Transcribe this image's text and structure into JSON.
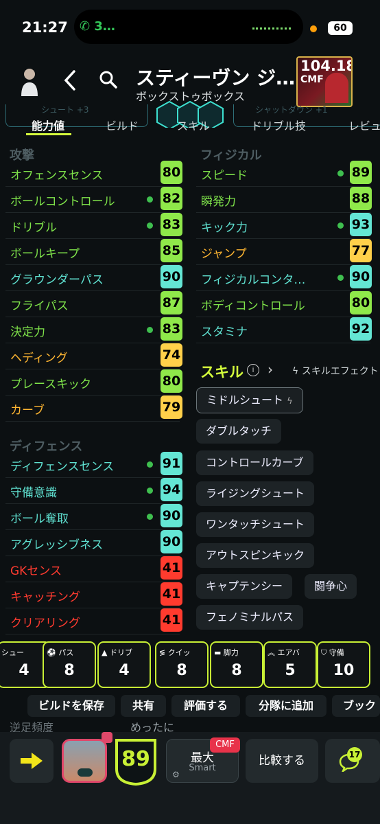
{
  "status": {
    "time": "21:27",
    "call": "3…",
    "battery": "60"
  },
  "header": {
    "player_name": "スティーヴン ジ…",
    "player_style": "ボックストゥボックス",
    "card_ovr": "104.18",
    "card_pos": "CMF"
  },
  "tabs": [
    {
      "label": "能力値"
    },
    {
      "label": "ビルド"
    },
    {
      "label": "スキル"
    },
    {
      "label": "ドリブル技"
    },
    {
      "label": "レビュ"
    }
  ],
  "ghost_tabs": [
    "シュート +3",
    "シャットダウン +1"
  ],
  "attack": {
    "title": "攻撃",
    "rows": [
      {
        "label": "オフェンスセンス",
        "value": "80",
        "dot": false,
        "color": "green"
      },
      {
        "label": "ボールコントロール",
        "value": "82",
        "dot": true,
        "color": "green"
      },
      {
        "label": "ドリブル",
        "value": "83",
        "dot": true,
        "color": "green"
      },
      {
        "label": "ボールキープ",
        "value": "85",
        "dot": false,
        "color": "green"
      },
      {
        "label": "グラウンダーパス",
        "value": "90",
        "dot": false,
        "color": "cyan"
      },
      {
        "label": "フライパス",
        "value": "87",
        "dot": false,
        "color": "green"
      },
      {
        "label": "決定力",
        "value": "83",
        "dot": true,
        "color": "green"
      },
      {
        "label": "ヘディング",
        "value": "74",
        "dot": false,
        "color": "orange"
      },
      {
        "label": "プレースキック",
        "value": "80",
        "dot": false,
        "color": "green"
      },
      {
        "label": "カーブ",
        "value": "79",
        "dot": false,
        "color": "orange"
      }
    ]
  },
  "defense": {
    "title": "ディフェンス",
    "rows": [
      {
        "label": "ディフェンスセンス",
        "value": "91",
        "dot": true,
        "color": "cyan"
      },
      {
        "label": "守備意識",
        "value": "94",
        "dot": true,
        "color": "cyan"
      },
      {
        "label": "ボール奪取",
        "value": "90",
        "dot": true,
        "color": "cyan"
      },
      {
        "label": "アグレッシブネス",
        "value": "90",
        "dot": false,
        "color": "cyan"
      },
      {
        "label": "GKセンス",
        "value": "41",
        "dot": false,
        "color": "red"
      },
      {
        "label": "キャッチング",
        "value": "41",
        "dot": false,
        "color": "red"
      },
      {
        "label": "クリアリング",
        "value": "41",
        "dot": false,
        "color": "red"
      }
    ]
  },
  "physical": {
    "title": "フィジカル",
    "rows": [
      {
        "label": "スピード",
        "value": "89",
        "dot": true,
        "color": "green"
      },
      {
        "label": "瞬発力",
        "value": "88",
        "dot": false,
        "color": "green"
      },
      {
        "label": "キック力",
        "value": "93",
        "dot": true,
        "color": "cyan"
      },
      {
        "label": "ジャンプ",
        "value": "77",
        "dot": false,
        "color": "orange"
      },
      {
        "label": "フィジカルコンタ…",
        "value": "90",
        "dot": true,
        "color": "cyan"
      },
      {
        "label": "ボディコントロール",
        "value": "80",
        "dot": false,
        "color": "green"
      },
      {
        "label": "スタミナ",
        "value": "92",
        "dot": false,
        "color": "cyan"
      }
    ]
  },
  "skills": {
    "title": "スキル",
    "effect_label": "スキルエフェクト",
    "items": [
      "ミドルシュート",
      "ダブルタッチ",
      "コントロールカーブ",
      "ライジングシュート",
      "ワンタッチシュート",
      "アウトスピンキック",
      "キャプテンシー",
      "闘争心",
      "フェノミナルパス"
    ]
  },
  "summary_cards": [
    {
      "label": "シュー",
      "value": "4"
    },
    {
      "label": "パス",
      "value": "8"
    },
    {
      "label": "ドリブ",
      "value": "4"
    },
    {
      "label": "クイッ",
      "value": "8"
    },
    {
      "label": "脚力",
      "value": "8"
    },
    {
      "label": "エアバ",
      "value": "5"
    },
    {
      "label": "守備",
      "value": "10"
    }
  ],
  "actions": [
    "ビルドを保存",
    "共有",
    "評価する",
    "分隊に追加",
    "ブック"
  ],
  "ghost_footer": {
    "left": "逆足頻度",
    "right": "めったに"
  },
  "bottom": {
    "ovr": "89",
    "max_label": "最大",
    "max_sub": "Smart",
    "pos_badge": "CMF",
    "compare": "比較する",
    "chat_count": "17"
  },
  "colors": {
    "accent": "#d5ff3c",
    "green": "#8fe84a",
    "cyan": "#64e6d4",
    "orange": "#ffb632",
    "red": "#ff3b2e"
  }
}
